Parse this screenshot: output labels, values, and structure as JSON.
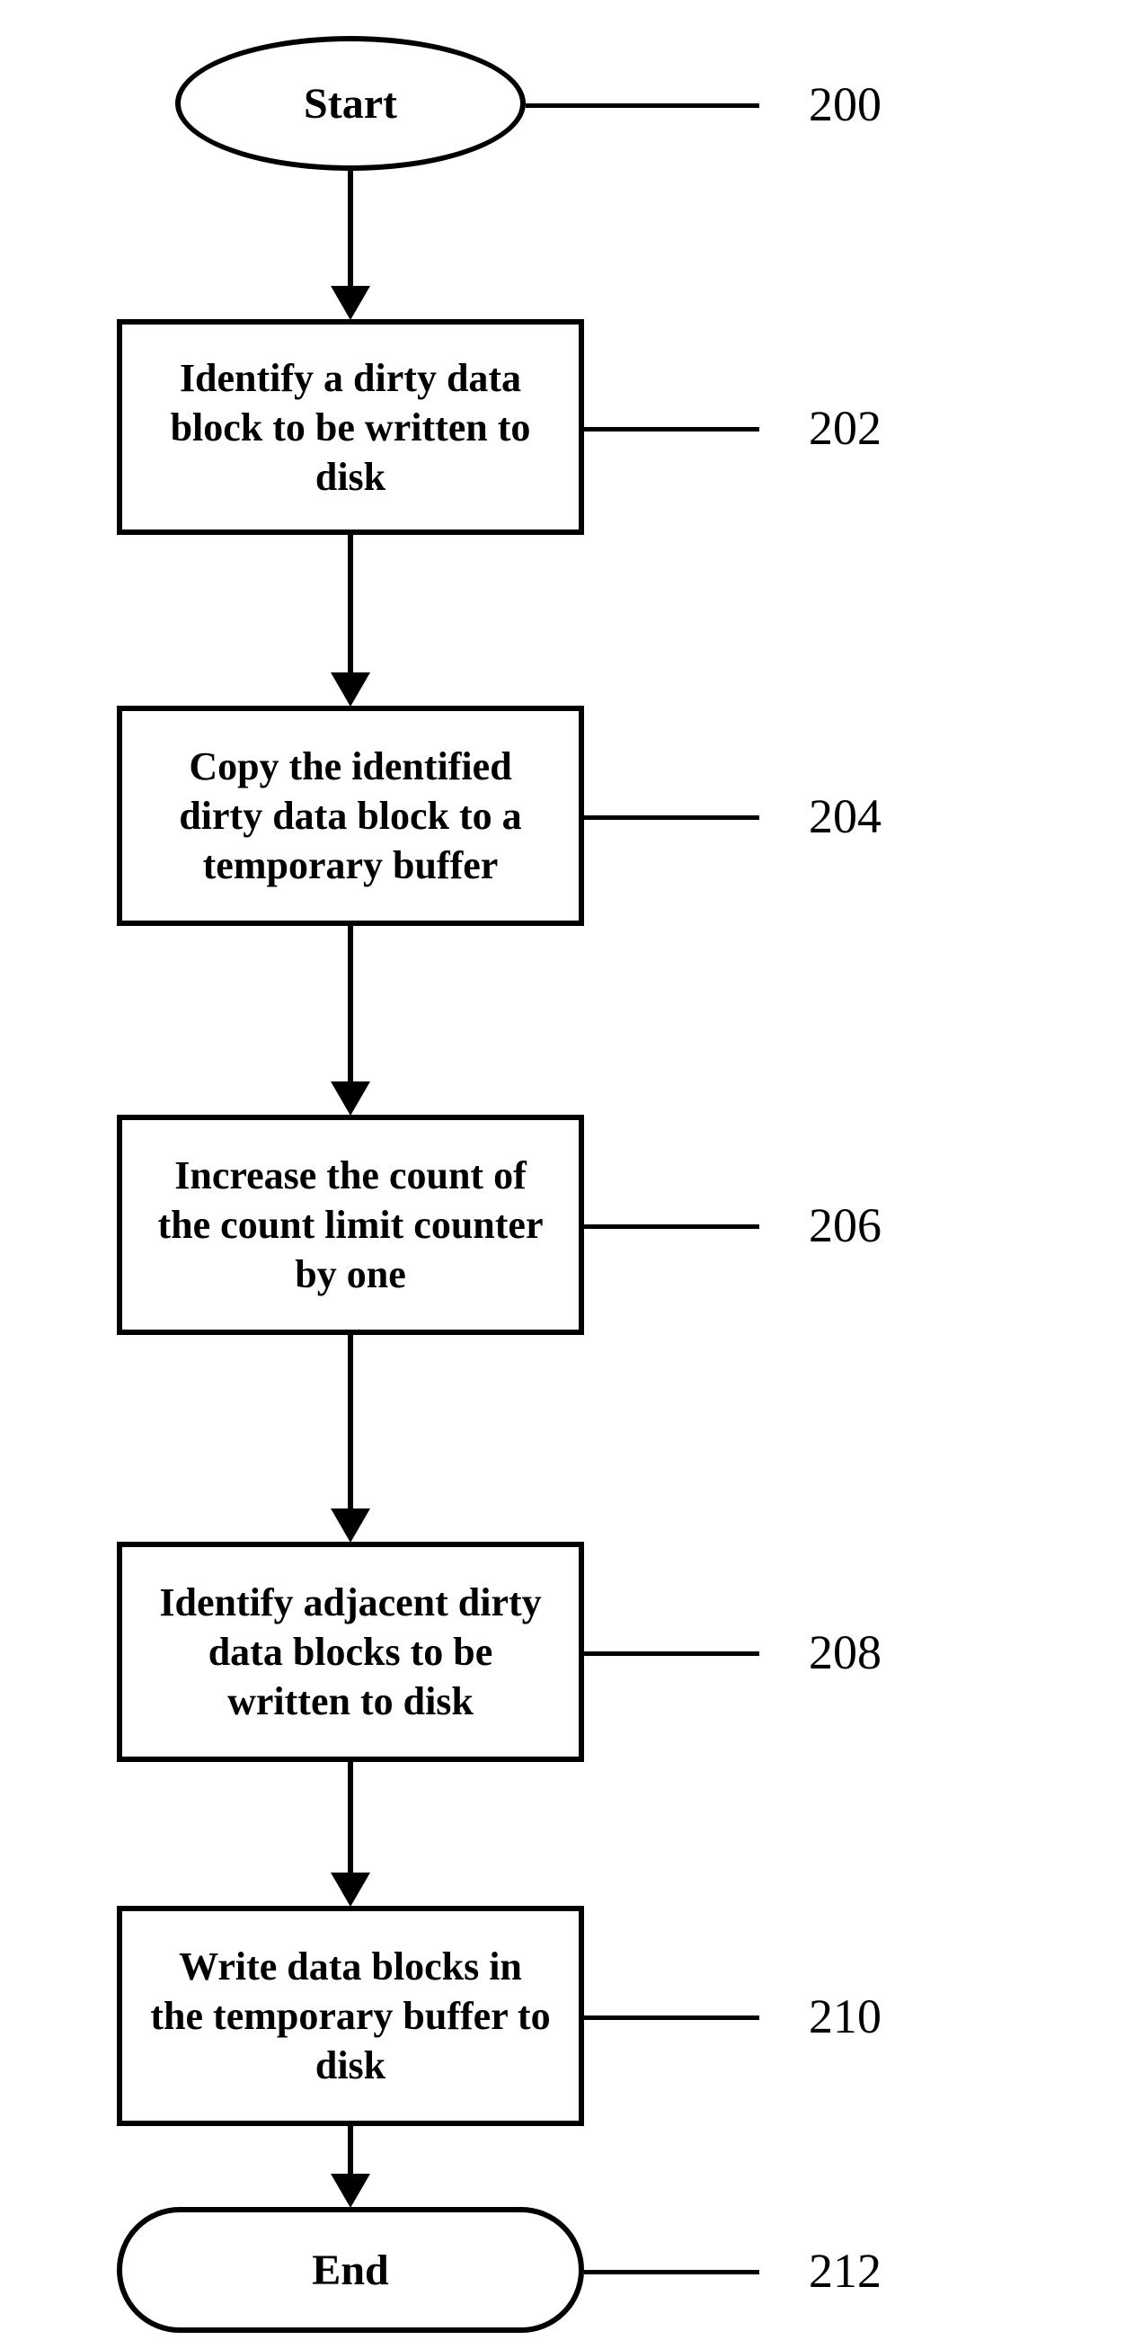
{
  "nodes": {
    "start": {
      "text": "Start",
      "ref": "200"
    },
    "step1": {
      "text": "Identify a dirty data block to be written to disk",
      "ref": "202"
    },
    "step2": {
      "text": "Copy the identified dirty data block to a temporary buffer",
      "ref": "204"
    },
    "step3": {
      "text": "Increase the count of the count limit counter by one",
      "ref": "206"
    },
    "step4": {
      "text": "Identify adjacent dirty data blocks to be written to disk",
      "ref": "208"
    },
    "step5": {
      "text": "Write data blocks in the temporary buffer to disk",
      "ref": "210"
    },
    "end": {
      "text": "End",
      "ref": "212"
    }
  }
}
